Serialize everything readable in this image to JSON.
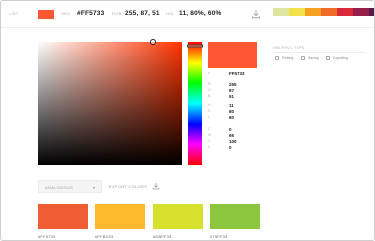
{
  "topbar": {
    "list_label": "LIST",
    "hex_label": "HEX",
    "hex_value": "#FF5733",
    "rgb_label": "RGB",
    "rgb_value": "255, 87, 51",
    "hsl_label": "HSL",
    "hsl_value": "11, 80%, 60%",
    "download_icon": "download-icon",
    "palette": [
      {
        "color": "#DCE6A0",
        "name": ""
      },
      {
        "color": "#F2E14A",
        "name": ""
      },
      {
        "color": "#F7A020",
        "name": ""
      },
      {
        "color": "#F06A28",
        "name": ""
      },
      {
        "color": "#D8283A",
        "name": ""
      },
      {
        "color": "#961E4A",
        "name": ""
      },
      {
        "color": "#5A1A48",
        "name": ""
      }
    ]
  },
  "picker": {
    "hue_color": "#FF3300",
    "saturation_fraction": 0.8,
    "value_fraction": 1.0,
    "hue_fraction": 0.03,
    "selected_color": "#FF5733"
  },
  "values": [
    {
      "key": "#",
      "value": "FF5733"
    },
    {
      "key": "R",
      "value": "255"
    },
    {
      "key": "G",
      "value": "87"
    },
    {
      "key": "B",
      "value": "51"
    },
    {
      "key": "H",
      "value": "11"
    },
    {
      "key": "S",
      "value": "80"
    },
    {
      "key": "L",
      "value": "60"
    },
    {
      "key": "C",
      "value": "0"
    },
    {
      "key": "M",
      "value": "66"
    },
    {
      "key": "Y",
      "value": "100"
    },
    {
      "key": "K",
      "value": "0"
    }
  ],
  "sidebar": {
    "title": "HELPFUL TIPS",
    "tips": [
      {
        "label": "Picking",
        "icon": "eyedropper-icon"
      },
      {
        "label": "Saving",
        "icon": "heart-icon"
      },
      {
        "label": "Exporting",
        "icon": "export-icon"
      }
    ]
  },
  "scheme": {
    "select_label": "ANALOGOUS",
    "export_label": "EXPORT COLORS",
    "swatches": [
      {
        "color": "#F05D33",
        "label": "#FF5733"
      },
      {
        "color": "#FDBA2C",
        "label": "#FFBD33"
      },
      {
        "color": "#D6E12D",
        "label": "#DBFF33"
      },
      {
        "color": "#8CC63F",
        "label": "#75FF33"
      }
    ]
  }
}
